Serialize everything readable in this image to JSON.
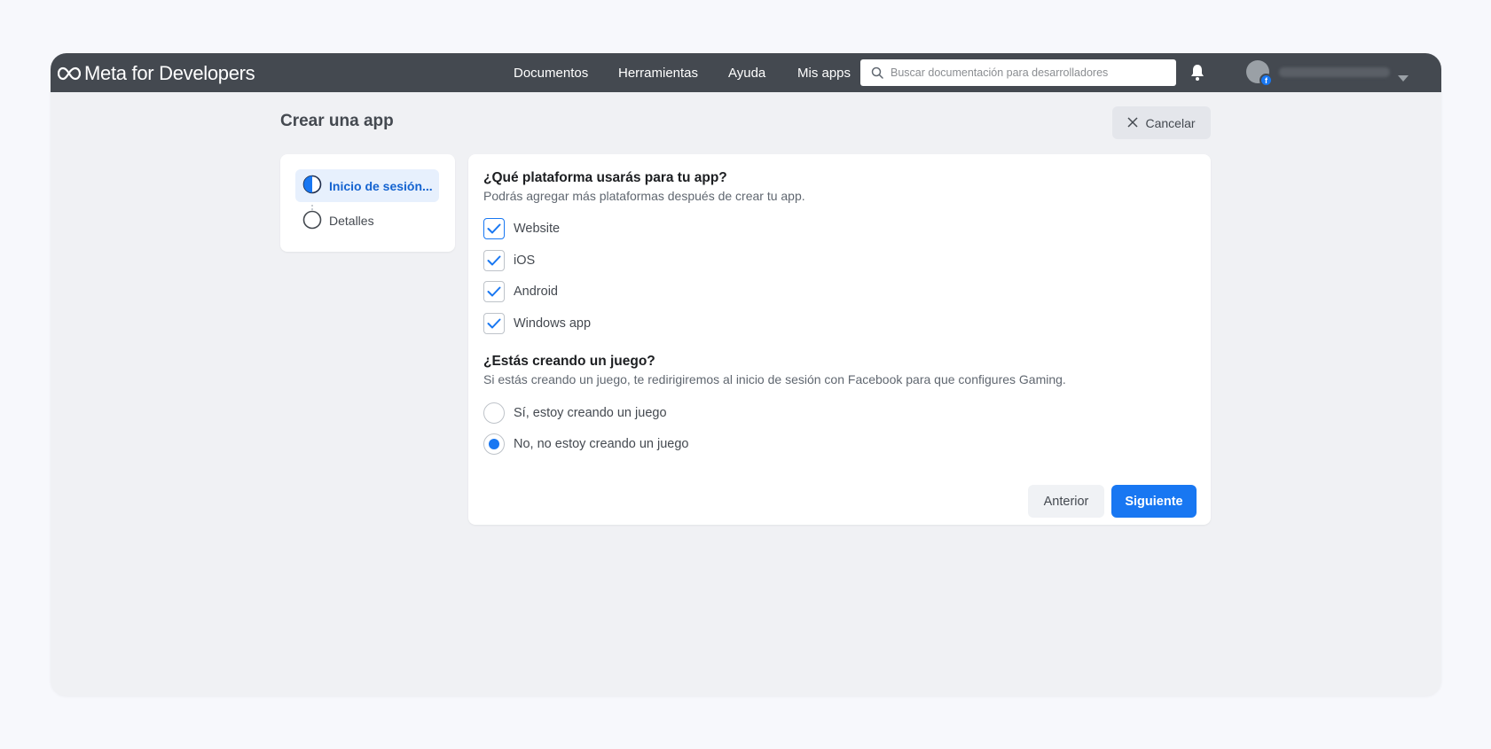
{
  "header": {
    "brand": "Meta for Developers",
    "nav": [
      "Documentos",
      "Herramientas",
      "Ayuda",
      "Mis apps"
    ],
    "search_placeholder": "Buscar documentación para desarrolladores"
  },
  "page": {
    "title": "Crear una app",
    "cancel_label": "Cancelar"
  },
  "steps": [
    {
      "label": "Inicio de sesión...",
      "state": "active"
    },
    {
      "label": "Detalles",
      "state": "pending"
    }
  ],
  "platform_section": {
    "title": "¿Qué plataforma usarás para tu app?",
    "subtitle": "Podrás agregar más plataformas después de crear tu app.",
    "options": [
      {
        "label": "Website",
        "checked": true
      },
      {
        "label": "iOS",
        "checked": true
      },
      {
        "label": "Android",
        "checked": true
      },
      {
        "label": "Windows app",
        "checked": true
      }
    ]
  },
  "game_section": {
    "title": "¿Estás creando un juego?",
    "subtitle": "Si estás creando un juego, te redirigiremos al inicio de sesión con Facebook para que configures Gaming.",
    "options": [
      {
        "label": "Sí, estoy creando un juego",
        "selected": false
      },
      {
        "label": "No, no estoy creando un juego",
        "selected": true
      }
    ]
  },
  "actions": {
    "previous_label": "Anterior",
    "next_label": "Siguiente"
  },
  "colors": {
    "topbar": "#444950",
    "primary": "#1877f2",
    "active_step_bg": "#e7f0fd"
  }
}
